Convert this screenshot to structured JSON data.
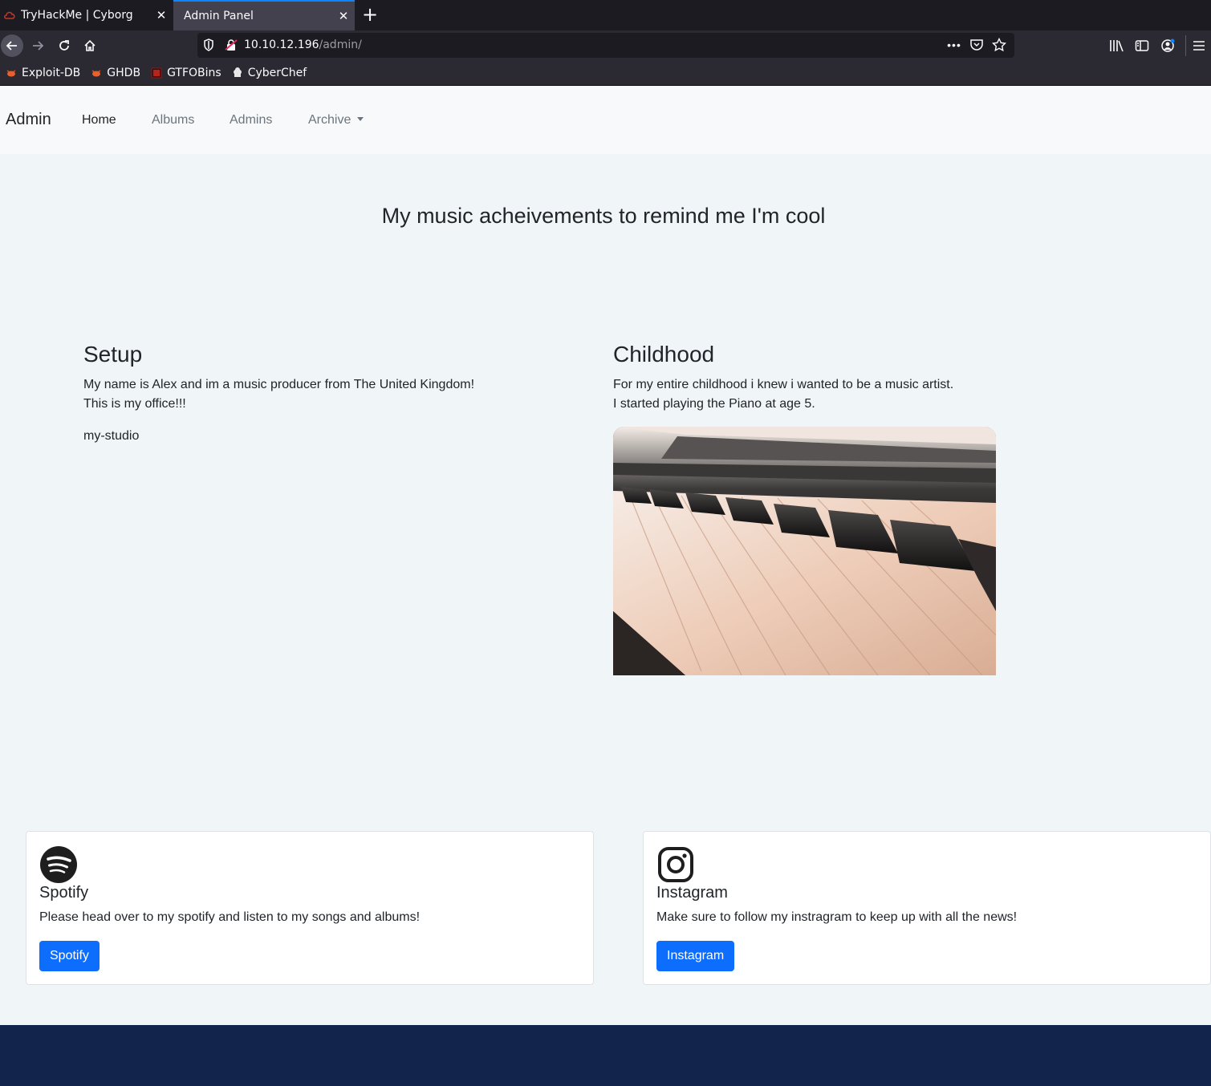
{
  "browser": {
    "tabs": [
      {
        "title": "TryHackMe | Cyborg",
        "active": false
      },
      {
        "title": "Admin Panel",
        "active": true
      }
    ],
    "url": {
      "host": "10.10.12.196",
      "path": "/admin/"
    },
    "bookmarks": [
      {
        "label": "Exploit-DB",
        "icon": "bug-icon"
      },
      {
        "label": "GHDB",
        "icon": "bug-icon"
      },
      {
        "label": "GTFOBins",
        "icon": "gtfobins-icon"
      },
      {
        "label": "CyberChef",
        "icon": "chef-icon"
      }
    ],
    "accent_color": "#0a84ff"
  },
  "site": {
    "brand": "Admin",
    "nav": {
      "home": "Home",
      "albums": "Albums",
      "admins": "Admins",
      "archive": "Archive"
    },
    "hero_title": "My music acheivements to remind me I'm cool",
    "setup": {
      "heading": "Setup",
      "line1": "My name is Alex and im a music producer from The United Kingdom!",
      "line2": "This is my office!!!",
      "extra": "my-studio"
    },
    "childhood": {
      "heading": "Childhood",
      "line1": "For my entire childhood i knew i wanted to be a music artist.",
      "line2": "I started playing the Piano at age 5.",
      "image": "piano-keys-photo"
    },
    "cards": {
      "spotify": {
        "icon": "spotify-icon",
        "title": "Spotify",
        "text": "Please head over to my spotify and listen to my songs and albums!",
        "button": "Spotify"
      },
      "instagram": {
        "icon": "instagram-icon",
        "title": "Instagram",
        "text": "Make sure to follow my instragram to keep up with all the news!",
        "button": "Instagram"
      }
    },
    "colors": {
      "primary": "#0d6efd",
      "footer": "#13244c",
      "background": "#f0f5f7"
    }
  }
}
